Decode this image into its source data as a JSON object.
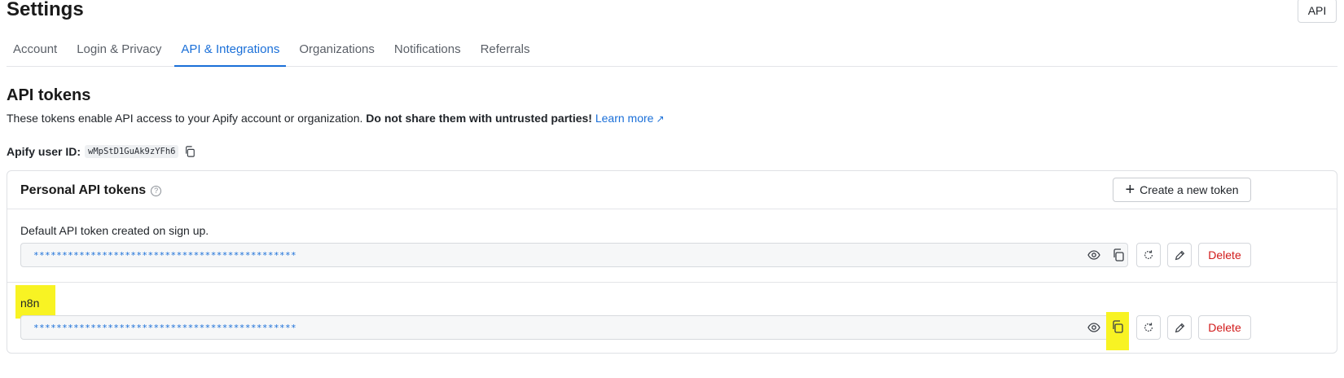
{
  "header": {
    "title": "Settings",
    "api_button": "API"
  },
  "tabs": [
    {
      "label": "Account",
      "active": false
    },
    {
      "label": "Login & Privacy",
      "active": false
    },
    {
      "label": "API & Integrations",
      "active": true
    },
    {
      "label": "Organizations",
      "active": false
    },
    {
      "label": "Notifications",
      "active": false
    },
    {
      "label": "Referrals",
      "active": false
    }
  ],
  "api_tokens": {
    "title": "API tokens",
    "description": "These tokens enable API access to your Apify account or organization.",
    "warning": "Do not share them with untrusted parties!",
    "learn_more": "Learn more",
    "learn_more_arrow": "↗",
    "user_id_label": "Apify user ID:",
    "user_id_value": "wMpStD1GuAk9zYFh6"
  },
  "personal_tokens": {
    "title": "Personal API tokens",
    "help_icon": "?",
    "create_button": "Create a new token",
    "create_icon": "+",
    "tokens": [
      {
        "label": "Default API token created on sign up.",
        "masked_value": "**********************************************",
        "delete_label": "Delete"
      },
      {
        "label": "n8n",
        "masked_value": "**********************************************",
        "delete_label": "Delete"
      }
    ]
  },
  "colors": {
    "accent": "#1a6fd8",
    "danger": "#d11a1a",
    "highlight": "#f8f323"
  }
}
